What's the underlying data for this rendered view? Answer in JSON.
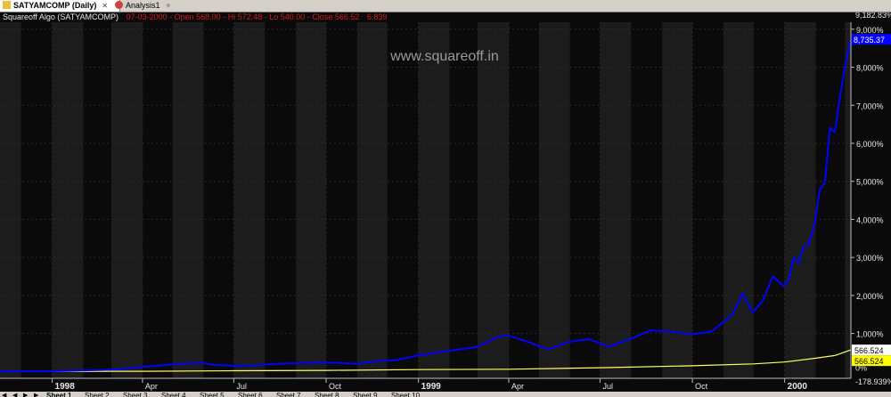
{
  "tabs": [
    {
      "label": "SATYAMCOMP (Daily)",
      "active": true
    },
    {
      "label": "Analysis1",
      "active": false
    }
  ],
  "info": {
    "name": "Squareoff Algo (SATYAMCOMP)",
    "date": "07-03-2000",
    "open": "Open 568.00",
    "hi": "Hi 572.48",
    "lo": "Lo 540.00",
    "close": "Close 566.52",
    "value": "6.839"
  },
  "watermark": "www.squareoff.in",
  "colors": {
    "background": "#0a0a0a",
    "band_light": "#1c1c1c",
    "equity_line": "#0000ff",
    "price_line": "#ffff66",
    "equity_label_bg": "#0000ff",
    "price_label_bg": "#ffff00",
    "info_text": "#c8201e"
  },
  "chart_data": {
    "type": "line",
    "title": "",
    "xlabel": "",
    "ylabel": "",
    "y_unit": "percent",
    "ylim": [
      -178.939,
      9182.83
    ],
    "y_ticks": [
      "1,000%",
      "2,000%",
      "3,000%",
      "4,000%",
      "5,000%",
      "6,000%",
      "7,000%",
      "8,000%",
      "9,000%"
    ],
    "y_max_label": "9,182.83%",
    "y_zero_label": "0%",
    "y_min_label": "-178.939%",
    "x_labels": [
      {
        "label": "1998",
        "major": true,
        "date": "1998-01-01"
      },
      {
        "label": "Apr",
        "major": false,
        "date": "1998-04-01"
      },
      {
        "label": "Jul",
        "major": false,
        "date": "1998-07-01"
      },
      {
        "label": "Oct",
        "major": false,
        "date": "1998-10-01"
      },
      {
        "label": "1999",
        "major": true,
        "date": "1999-01-01"
      },
      {
        "label": "Apr",
        "major": false,
        "date": "1999-04-01"
      },
      {
        "label": "Jul",
        "major": false,
        "date": "1999-07-01"
      },
      {
        "label": "Oct",
        "major": false,
        "date": "1999-10-01"
      },
      {
        "label": "2000",
        "major": true,
        "date": "2000-01-01"
      }
    ],
    "xlim": [
      "1997-11-10",
      "2000-03-07"
    ],
    "grid": true,
    "series": [
      {
        "name": "",
        "color": "#0000ff",
        "last_label": "8,735.37",
        "points": [
          [
            "1997-11-10",
            0
          ],
          [
            "1997-12-01",
            10
          ],
          [
            "1997-12-20",
            5
          ],
          [
            "1998-01-10",
            15
          ],
          [
            "1998-01-31",
            30
          ],
          [
            "1998-02-20",
            40
          ],
          [
            "1998-03-10",
            60
          ],
          [
            "1998-03-31",
            120
          ],
          [
            "1998-04-20",
            160
          ],
          [
            "1998-05-10",
            200
          ],
          [
            "1998-05-31",
            230
          ],
          [
            "1998-06-10",
            180
          ],
          [
            "1998-06-30",
            150
          ],
          [
            "1998-07-20",
            160
          ],
          [
            "1998-08-10",
            200
          ],
          [
            "1998-08-31",
            220
          ],
          [
            "1998-09-20",
            230
          ],
          [
            "1998-10-10",
            230
          ],
          [
            "1998-10-31",
            200
          ],
          [
            "1998-11-20",
            270
          ],
          [
            "1998-12-10",
            300
          ],
          [
            "1998-12-31",
            420
          ],
          [
            "1999-01-20",
            500
          ],
          [
            "1999-02-10",
            580
          ],
          [
            "1999-03-01",
            650
          ],
          [
            "1999-03-20",
            900
          ],
          [
            "1999-03-31",
            950
          ],
          [
            "1999-04-20",
            780
          ],
          [
            "1999-05-10",
            580
          ],
          [
            "1999-05-31",
            780
          ],
          [
            "1999-06-20",
            850
          ],
          [
            "1999-07-10",
            650
          ],
          [
            "1999-07-31",
            850
          ],
          [
            "1999-08-20",
            1080
          ],
          [
            "1999-09-10",
            1050
          ],
          [
            "1999-09-30",
            980
          ],
          [
            "1999-10-20",
            1050
          ],
          [
            "1999-11-10",
            1500
          ],
          [
            "1999-11-20",
            2050
          ],
          [
            "1999-11-30",
            1550
          ],
          [
            "1999-12-10",
            1850
          ],
          [
            "1999-12-20",
            2500
          ],
          [
            "1999-12-31",
            2250
          ],
          [
            "2000-01-05",
            2400
          ],
          [
            "2000-01-10",
            3000
          ],
          [
            "2000-01-15",
            2850
          ],
          [
            "2000-01-20",
            3300
          ],
          [
            "2000-01-25",
            3350
          ],
          [
            "2000-01-31",
            3900
          ],
          [
            "2000-02-05",
            4800
          ],
          [
            "2000-02-10",
            4950
          ],
          [
            "2000-02-15",
            6400
          ],
          [
            "2000-02-20",
            6300
          ],
          [
            "2000-02-25",
            7200
          ],
          [
            "2000-03-01",
            8000
          ],
          [
            "2000-03-07",
            8735.37
          ]
        ]
      },
      {
        "name": "",
        "color": "#ffff66",
        "last_label": "566.524",
        "points": [
          [
            "1997-11-10",
            0
          ],
          [
            "1998-04-01",
            5
          ],
          [
            "1998-07-01",
            20
          ],
          [
            "1998-10-01",
            30
          ],
          [
            "1999-01-01",
            50
          ],
          [
            "1999-04-01",
            60
          ],
          [
            "1999-07-01",
            100
          ],
          [
            "1999-10-01",
            150
          ],
          [
            "1999-12-01",
            200
          ],
          [
            "2000-01-01",
            250
          ],
          [
            "2000-02-01",
            350
          ],
          [
            "2000-02-20",
            420
          ],
          [
            "2000-03-07",
            566.524
          ]
        ]
      }
    ]
  },
  "sheets": [
    {
      "label": "Sheet 1",
      "active": true
    },
    {
      "label": "Sheet 2",
      "active": false
    },
    {
      "label": "Sheet 3",
      "active": false
    },
    {
      "label": "Sheet 4",
      "active": false
    },
    {
      "label": "Sheet 5",
      "active": false
    },
    {
      "label": "Sheet 6",
      "active": false
    },
    {
      "label": "Sheet 7",
      "active": false
    },
    {
      "label": "Sheet 8",
      "active": false
    },
    {
      "label": "Sheet 9",
      "active": false
    },
    {
      "label": "Sheet 10",
      "active": false
    }
  ]
}
